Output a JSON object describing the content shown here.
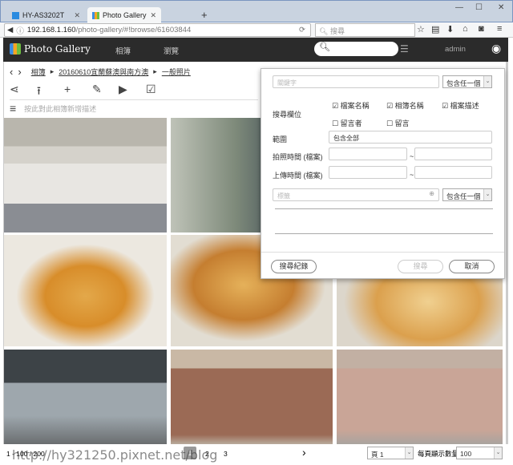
{
  "browser": {
    "tabs": [
      {
        "title": "HY-AS3202T"
      },
      {
        "title": "Photo Gallery"
      }
    ],
    "new_tab": "+",
    "url_host": "192.168.1.160",
    "url_path": "/photo-gallery/#!browse/61603844",
    "search_placeholder": "搜尋",
    "win": [
      "—",
      "☐",
      "✕"
    ]
  },
  "app": {
    "title": "Photo Gallery",
    "nav": [
      "相簿",
      "瀏覽"
    ],
    "user": "admin"
  },
  "breadcrumb": [
    "相簿",
    "20160610宜蘭蘇澳與南方澳",
    "一般照片"
  ],
  "description_placeholder": "按此對此相簿新增描述",
  "search_panel": {
    "keyword_placeholder": "關鍵字",
    "match_mode": "包含任一個",
    "fields_label": "搜尋欄位",
    "fields": [
      {
        "label": "檔案名稱",
        "checked": true
      },
      {
        "label": "相簿名稱",
        "checked": true
      },
      {
        "label": "檔案描述",
        "checked": true
      },
      {
        "label": "留言者",
        "checked": false
      },
      {
        "label": "留言",
        "checked": false
      }
    ],
    "range_label": "範圍",
    "range_value": "包含全部",
    "taken_label": "拍照時間 (檔案)",
    "upload_label": "上傳時間 (檔案)",
    "tilde": "~",
    "tag_placeholder": "標籤",
    "tag_match_mode": "包含任一個",
    "history_button": "搜尋紀錄",
    "search_button": "搜尋",
    "cancel_button": "取消"
  },
  "pagination": {
    "range": "1 - 100 / 200",
    "pages": [
      "1",
      "2",
      "3"
    ],
    "current_page": "1",
    "page_select": "頁 1",
    "per_page_label": "每頁顯示數量",
    "per_page": "100"
  },
  "watermark": "http://hy321250.pixnet.net/blog"
}
